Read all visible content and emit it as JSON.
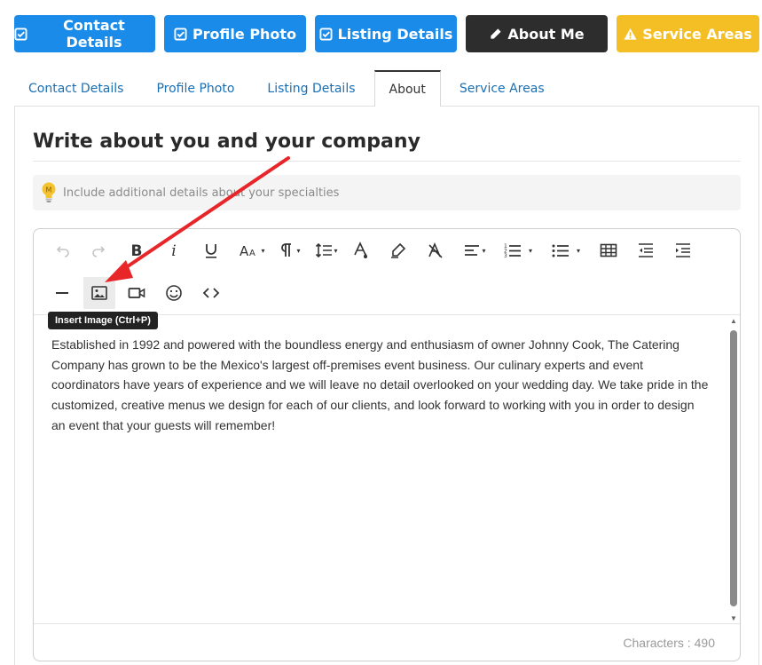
{
  "steps": [
    {
      "label": "Contact Details",
      "icon": "check-square-icon",
      "color": "#1a8be8"
    },
    {
      "label": "Profile Photo",
      "icon": "check-square-icon",
      "color": "#1a8be8"
    },
    {
      "label": "Listing Details",
      "icon": "check-square-icon",
      "color": "#1a8be8"
    },
    {
      "label": "About Me",
      "icon": "pencil-icon",
      "color": "#2d2d2d"
    },
    {
      "label": "Service Areas",
      "icon": "warning-icon",
      "color": "#f4bf24"
    }
  ],
  "tabs": [
    {
      "label": "Contact Details",
      "active": false
    },
    {
      "label": "Profile Photo",
      "active": false
    },
    {
      "label": "Listing Details",
      "active": false
    },
    {
      "label": "About",
      "active": true
    },
    {
      "label": "Service Areas",
      "active": false
    }
  ],
  "panel": {
    "heading": "Write about you and your company",
    "hint": "Include additional details about your specialties",
    "hint_icon": "lightbulb-icon"
  },
  "editor": {
    "tooltip": "Insert Image (Ctrl+P)",
    "content": "Established in 1992 and powered with the boundless energy and enthusiasm of owner Johnny Cook, The Catering Company has grown to be the Mexico's largest off-premises event business. Our culinary experts and event coordinators have years of experience and we will leave no detail overlooked on your wedding day. We take pride in the customized, creative menus we design for each of our clients, and look forward to working with you in order to design an event that your guests will remember!",
    "char_label": "Characters :",
    "char_count": "490",
    "toolbar": [
      "undo-icon",
      "redo-icon",
      "bold-icon",
      "italic-icon",
      "underline-icon",
      "font-size-icon",
      "paragraph-format-icon",
      "line-height-icon",
      "text-color-icon",
      "highlight-icon",
      "clear-format-icon",
      "align-icon",
      "ordered-list-icon",
      "unordered-list-icon",
      "table-icon",
      "outdent-icon",
      "indent-icon",
      "horizontal-line-icon",
      "insert-image-icon",
      "insert-video-icon",
      "emoticon-icon",
      "code-view-icon"
    ]
  },
  "colors": {
    "accent_blue": "#1a8be8",
    "dark": "#2d2d2d",
    "warning": "#f4bf24",
    "arrow": "#e8262a"
  }
}
